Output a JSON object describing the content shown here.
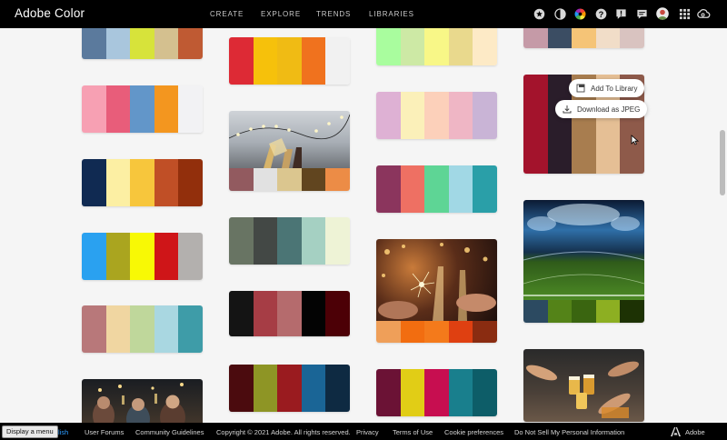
{
  "app": {
    "title": "Adobe Color"
  },
  "nav": {
    "items": [
      "CREATE",
      "EXPLORE",
      "TRENDS",
      "LIBRARIES"
    ]
  },
  "topbar_icons": [
    "gear-icon",
    "contrast-icon",
    "color-wheel-icon",
    "help-icon",
    "feedback-icon",
    "chat-icon",
    "avatar",
    "apps-grid-icon",
    "creative-cloud-icon"
  ],
  "palettes": {
    "c1a": [
      "#5b7a9d",
      "#a9c6dd",
      "#d7e33a",
      "#d4c08f",
      "#bf5a33"
    ],
    "c1b": [
      "#f7a0b3",
      "#e85d7a",
      "#6296c9",
      "#f3961f",
      "#f2f2f4"
    ],
    "c1c": [
      "#102a52",
      "#fcefa3",
      "#f7c63c",
      "#c04f26",
      "#922f0c"
    ],
    "c1d": [
      "#2aa1f0",
      "#aaa51f",
      "#f8f905",
      "#cf1518",
      "#b3b0ae"
    ],
    "c1e": [
      "#b8787a",
      "#f0d6a1",
      "#bfd79b",
      "#a9d7e1",
      "#3e9ca8"
    ],
    "c2a": [
      "#dd2a35",
      "#f6c10b",
      "#f0bb14",
      "#f0721e",
      "#f1f1f1"
    ],
    "c2b": [
      "#925a5f",
      "#e1e1e1",
      "#dbc68f",
      "#61451f",
      "#ec8c46"
    ],
    "c2c": [
      "#687463",
      "#434845",
      "#4b7575",
      "#a5d0c2",
      "#eef3d6"
    ],
    "c2d": [
      "#141414",
      "#a63d45",
      "#b56b6d",
      "#030303",
      "#4c0006"
    ],
    "c2e": [
      "#4b0b0e",
      "#8e9525",
      "#9a1b1f",
      "#1a6596",
      "#0e2a42"
    ],
    "c3a": [
      "#a9fd9e",
      "#cde9a5",
      "#f8f787",
      "#e9d98d",
      "#fdeac6"
    ],
    "c3b": [
      "#deb1d4",
      "#fbf0b9",
      "#fcd0ba",
      "#efb6c5",
      "#c9b4d6"
    ],
    "c3c": [
      "#8b355d",
      "#ee7063",
      "#5ed595",
      "#a1d8e5",
      "#2a9fa8"
    ],
    "c3d": [
      "#ef9f59",
      "#f26d10",
      "#f47a1b",
      "#df4011",
      "#8a2c11"
    ],
    "c3e": [
      "#6b1235",
      "#e1cd16",
      "#c70e50",
      "#197f8d",
      "#0d5d68"
    ],
    "c4a": [
      "#c59aa7",
      "#3b4d63",
      "#f5c477",
      "#f1ddc8",
      "#d9c3c0"
    ],
    "c4b": [
      "#a3132c",
      "#2a1d2a",
      "#a87d4f",
      "#e5bf95",
      "#8e5a4a"
    ],
    "c4c": [
      "#2c4a61",
      "#548318",
      "#3a6510",
      "#8daf22",
      "#1d3204"
    ]
  },
  "hover_actions": {
    "add_to_library": "Add To Library",
    "download_jpeg": "Download as JPEG"
  },
  "footer": {
    "language_suffix": "lish",
    "links": [
      "User Forums",
      "Community Guidelines",
      "Copyright © 2021 Adobe. All rights reserved.",
      "Privacy",
      "Terms of Use",
      "Cookie preferences",
      "Do Not Sell My Personal Information"
    ],
    "adobe_label": "Adobe"
  },
  "tooltip": {
    "label": "Display a menu"
  },
  "colors": {
    "accent_link": "#2d9cff"
  }
}
